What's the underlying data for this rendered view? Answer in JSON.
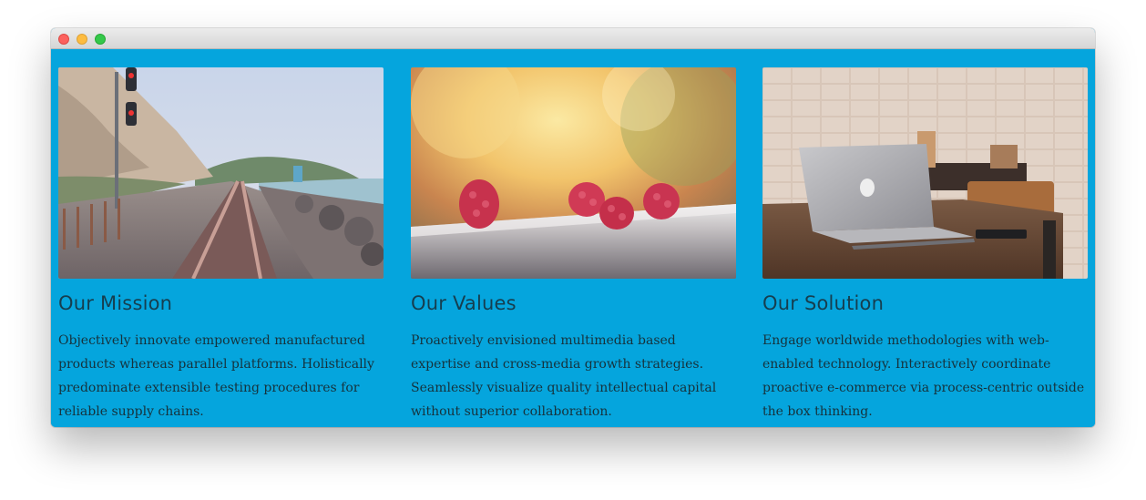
{
  "window": {
    "controls": [
      "close-icon",
      "minimize-icon",
      "maximize-icon"
    ]
  },
  "colors": {
    "background": "#05a5dd",
    "heading": "#163e4f",
    "body_text": "#16323c"
  },
  "cards": [
    {
      "title": "Our Mission",
      "text": "Objectively innovate empowered manufactured products whereas parallel platforms. Holistically predominate extensible testing procedures for reliable supply chains.",
      "image": "railroad-coast-photo"
    },
    {
      "title": "Our Values",
      "text": "Proactively envisioned multimedia based expertise and cross-media growth strategies. Seamlessly visualize quality intellectual capital without superior collaboration.",
      "image": "raspberries-photo"
    },
    {
      "title": "Our Solution",
      "text": "Engage worldwide methodologies with web-enabled technology. Interactively coordinate proactive e-commerce via process-centric outside the box thinking.",
      "image": "laptop-desk-photo"
    }
  ]
}
